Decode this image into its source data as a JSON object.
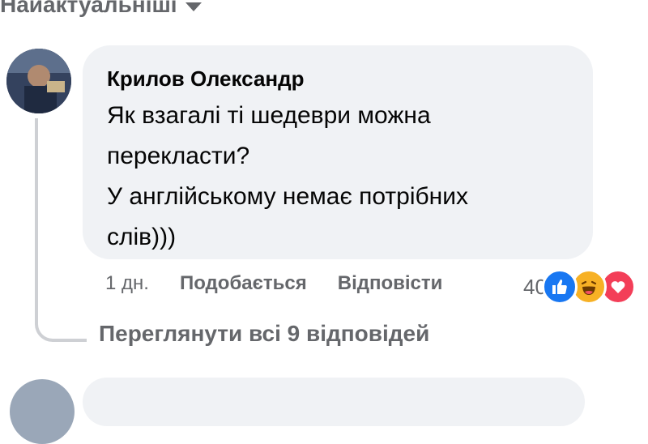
{
  "sort": {
    "label": "Найактуальніші",
    "icon": "caret-down-icon"
  },
  "comment": {
    "author": "Крилов Олександр",
    "text_lines": [
      "Як взагалі ті шедеври можна",
      "перекласти?",
      "У англійському немає потрібних",
      "слів)))"
    ],
    "time": "1 дн.",
    "like_label": "Подобається",
    "reply_label": "Відповісти",
    "reaction_count": "40",
    "reactions": [
      "like-icon",
      "haha-icon",
      "love-icon"
    ]
  },
  "view_replies": "Переглянути всі 9 відповідей",
  "colors": {
    "secondary_text": "#65676b",
    "bubble_bg": "#f0f2f5",
    "like": "#1877f2",
    "haha": "#f7b125",
    "love": "#f33e58"
  }
}
